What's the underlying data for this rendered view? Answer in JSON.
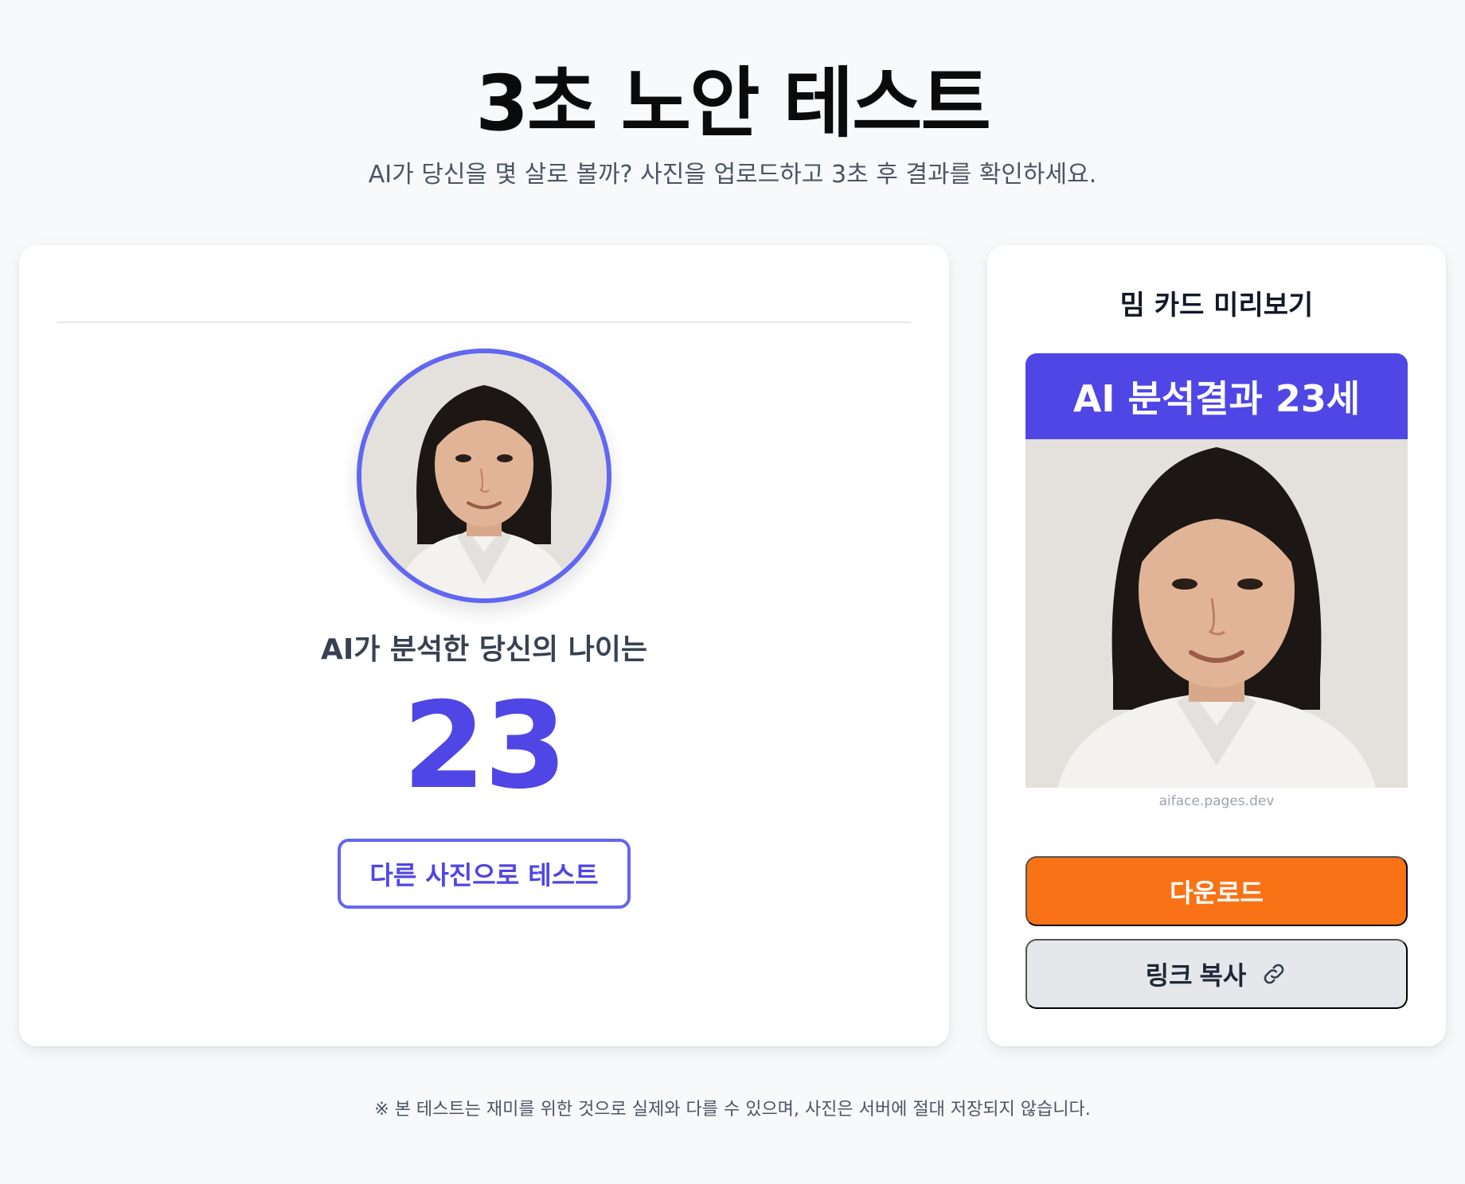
{
  "header": {
    "title": "3초 노안 테스트",
    "subtitle": "AI가 당신을 몇 살로 볼까? 사진을 업로드하고 3초 후 결과를 확인하세요."
  },
  "result": {
    "label": "AI가 분석한 당신의 나이는",
    "age": "23",
    "retry_button": "다른 사진으로 테스트"
  },
  "meme_preview": {
    "title": "밈 카드 미리보기",
    "banner": "AI 분석결과 23세",
    "url": "aiface.pages.dev",
    "download_button": "다운로드",
    "copy_link_button": "링크 복사",
    "copy_icon": "link-icon"
  },
  "footer": {
    "notice": "※ 본 테스트는 재미를 위한 것으로 실제와 다를 수 있으며, 사진은 서버에 절대 저장되지 않습니다."
  },
  "colors": {
    "accent": "#4f46e5",
    "accent_border": "#6366f1",
    "download": "#f97316",
    "secondary_button": "#e5e7eb"
  }
}
